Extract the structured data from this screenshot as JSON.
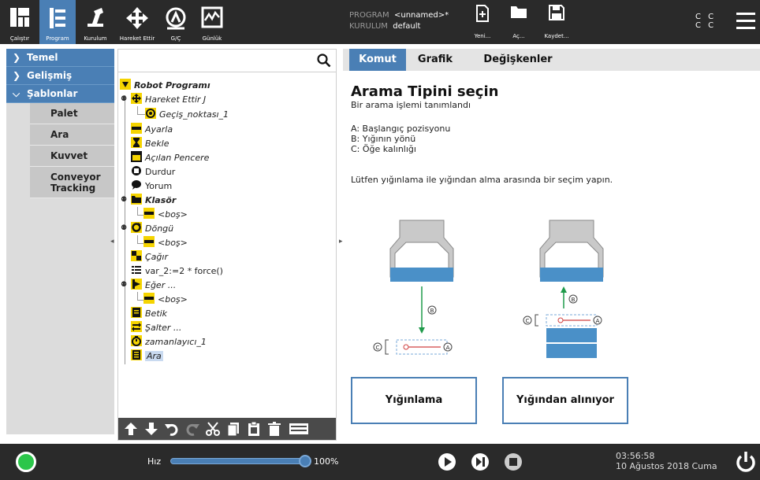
{
  "header": {
    "nav": [
      {
        "label": "Çalıştır",
        "icon": "ur-logo-icon"
      },
      {
        "label": "Program",
        "icon": "program-icon",
        "active": true
      },
      {
        "label": "Kurulum",
        "icon": "robot-arm-icon"
      },
      {
        "label": "Hareket Ettir",
        "icon": "move-arrows-icon"
      },
      {
        "label": "G/Ç",
        "icon": "io-icon"
      },
      {
        "label": "Günlük",
        "icon": "log-icon"
      }
    ],
    "program_key": "PROGRAM",
    "program_value": "<unnamed>*",
    "installation_key": "KURULUM",
    "installation_value": "default",
    "file_buttons": [
      {
        "label": "Yeni...",
        "icon": "new-file-icon"
      },
      {
        "label": "Aç...",
        "icon": "folder-icon"
      },
      {
        "label": "Kaydet...",
        "icon": "save-icon"
      }
    ],
    "cc_top": "C C",
    "cc_bottom": "C C",
    "colors": {
      "bar": "#2a2a2a",
      "accent": "#4a7fb5"
    }
  },
  "sidebar": {
    "sections": [
      {
        "label": "Temel",
        "expanded": false
      },
      {
        "label": "Gelişmiş",
        "expanded": false
      },
      {
        "label": "Şablonlar",
        "expanded": true
      }
    ],
    "items": [
      {
        "label": "Palet"
      },
      {
        "label": "Ara"
      },
      {
        "label": "Kuvvet"
      },
      {
        "label": "Conveyor Tracking"
      }
    ]
  },
  "tree": {
    "search_placeholder": "",
    "root": "Robot Programı",
    "nodes": [
      {
        "label": "Hareket Ettir J",
        "icon": "move-icon",
        "italic": true
      },
      {
        "label": "Geçiş_noktası_1",
        "icon": "waypoint-icon",
        "italic": true
      },
      {
        "label": "Ayarla",
        "icon": "set-icon",
        "italic": true
      },
      {
        "label": "Bekle",
        "icon": "hourglass-icon",
        "italic": true
      },
      {
        "label": "Açılan Pencere",
        "icon": "popup-icon",
        "italic": true
      },
      {
        "label": "Durdur",
        "icon": "stop-icon",
        "italic": false
      },
      {
        "label": "Yorum",
        "icon": "comment-icon",
        "italic": false,
        "gray": true
      },
      {
        "label": "Klasör",
        "icon": "folder-icon",
        "bold": true
      },
      {
        "label": "<boş>",
        "icon": "empty-icon",
        "gray": true
      },
      {
        "label": "Döngü",
        "icon": "loop-icon",
        "italic": true
      },
      {
        "label": "<boş>",
        "icon": "empty-icon",
        "gray": true
      },
      {
        "label": "Çağır",
        "icon": "call-icon",
        "italic": true
      },
      {
        "label": "var_2:=2 * force()",
        "icon": "assignment-icon",
        "italic": false
      },
      {
        "label": "Eğer ...",
        "icon": "if-icon",
        "italic": true
      },
      {
        "label": "<boş>",
        "icon": "empty-icon",
        "gray": true
      },
      {
        "label": "Betik",
        "icon": "script-icon",
        "italic": true
      },
      {
        "label": "Şalter ...",
        "icon": "switch-icon",
        "italic": true
      },
      {
        "label": "zamanlayıcı_1",
        "icon": "timer-icon",
        "italic": true
      },
      {
        "label": "Ara",
        "icon": "search-template-icon",
        "italic": true,
        "selected": true
      }
    ],
    "toolbar": [
      "move-up-icon",
      "move-down-icon",
      "undo-icon",
      "redo-icon",
      "cut-icon",
      "copy-icon",
      "paste-icon",
      "delete-icon",
      "suppress-icon"
    ]
  },
  "tabs": [
    {
      "label": "Komut",
      "active": true
    },
    {
      "label": "Grafik"
    },
    {
      "label": "Değişkenler"
    }
  ],
  "content": {
    "title": "Arama Tipini seçin",
    "subtitle": "Bir arama işlemi tanımlandı",
    "legend": [
      "A: Başlangıç pozisyonu",
      "B: Yığının yönü",
      "C: Öğe kalınlığı"
    ],
    "prompt": "Lütfen yığınlama ile yığından alma arasında bir seçim yapın.",
    "diagram_labels": {
      "a": "A",
      "b": "B",
      "c": "C"
    },
    "buttons": {
      "stacking": "Yığınlama",
      "destacking": "Yığından alınıyor"
    }
  },
  "footer": {
    "speed_label": "Hız",
    "speed_value": "100%",
    "speed_fraction": 1.0,
    "time": "03:56:58",
    "date": "10 Ağustos 2018 Cuma",
    "status_color": "#2bc64a"
  }
}
